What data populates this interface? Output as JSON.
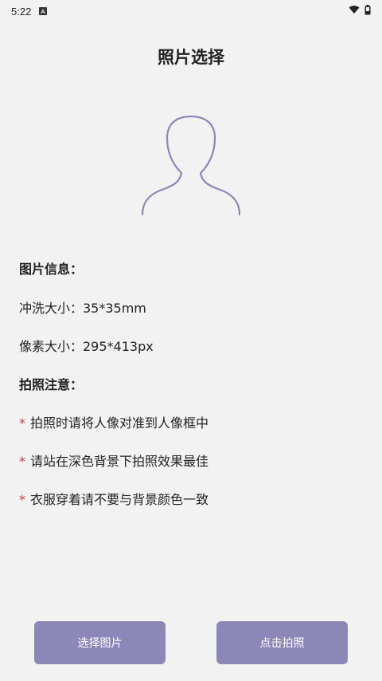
{
  "status_bar": {
    "time": "5:22",
    "icons": [
      "notification-a-icon",
      "wifi-icon",
      "battery-icon"
    ]
  },
  "page": {
    "title": "照片选择"
  },
  "image_info": {
    "heading": "图片信息：",
    "print_size": "冲洗大小：35*35mm",
    "pixel_size": "像素大小：295*413px"
  },
  "notes": {
    "heading": "拍照注意：",
    "star": "*",
    "items": [
      "拍照时请将人像对准到人像框中",
      "请站在深色背景下拍照效果最佳",
      "衣服穿着请不要与背景颜色一致"
    ]
  },
  "buttons": {
    "select_label": "选择图片",
    "camera_label": "点击拍照"
  },
  "colors": {
    "accent": "#8d87b8",
    "star": "#d4352f",
    "background": "#f2f2f3"
  }
}
